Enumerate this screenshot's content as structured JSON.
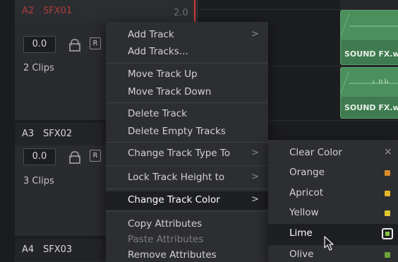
{
  "tracks": [
    {
      "id": "A2",
      "name": "SFX01",
      "extra": "2.0",
      "volume": "0.0",
      "record_label": "R",
      "clips": "2 Clips"
    },
    {
      "id": "A3",
      "name": "SFX02",
      "volume": "0.0",
      "record_label": "R",
      "clips": "3 Clips"
    },
    {
      "id": "A4",
      "name": "SFX03"
    }
  ],
  "timeline": {
    "clips": [
      {
        "label": "SOUND FX.w"
      },
      {
        "label": "SOUND FX.w"
      }
    ],
    "clip_color": "#4a8f5c",
    "playhead_color": "#d33a34"
  },
  "context_menu": {
    "items": [
      {
        "label": "Add Track",
        "submenu": true,
        "icon": "chevron-right-icon"
      },
      {
        "label": "Add Tracks..."
      },
      {
        "label": "Move Track Up"
      },
      {
        "label": "Move Track Down"
      },
      {
        "label": "Delete Track"
      },
      {
        "label": "Delete Empty Tracks"
      },
      {
        "label": "Change Track Type To",
        "submenu": true
      },
      {
        "label": "Lock Track Height to",
        "submenu": true
      },
      {
        "label": "Change Track Color",
        "submenu": true,
        "highlighted": true
      },
      {
        "label": "Copy Attributes"
      },
      {
        "label": "Paste Attributes",
        "disabled": true
      },
      {
        "label": "Remove Attributes"
      }
    ],
    "arrow_glyph": ">"
  },
  "color_submenu": {
    "items": [
      {
        "label": "Clear Color",
        "icon": "close-icon",
        "glyph": "×"
      },
      {
        "label": "Orange",
        "color": "#d98a2b"
      },
      {
        "label": "Apricot",
        "color": "#e4b62a"
      },
      {
        "label": "Yellow",
        "color": "#e0c830"
      },
      {
        "label": "Lime",
        "color": "#86c440",
        "selected": true
      },
      {
        "label": "Olive",
        "color": "#6aa53a"
      }
    ]
  }
}
